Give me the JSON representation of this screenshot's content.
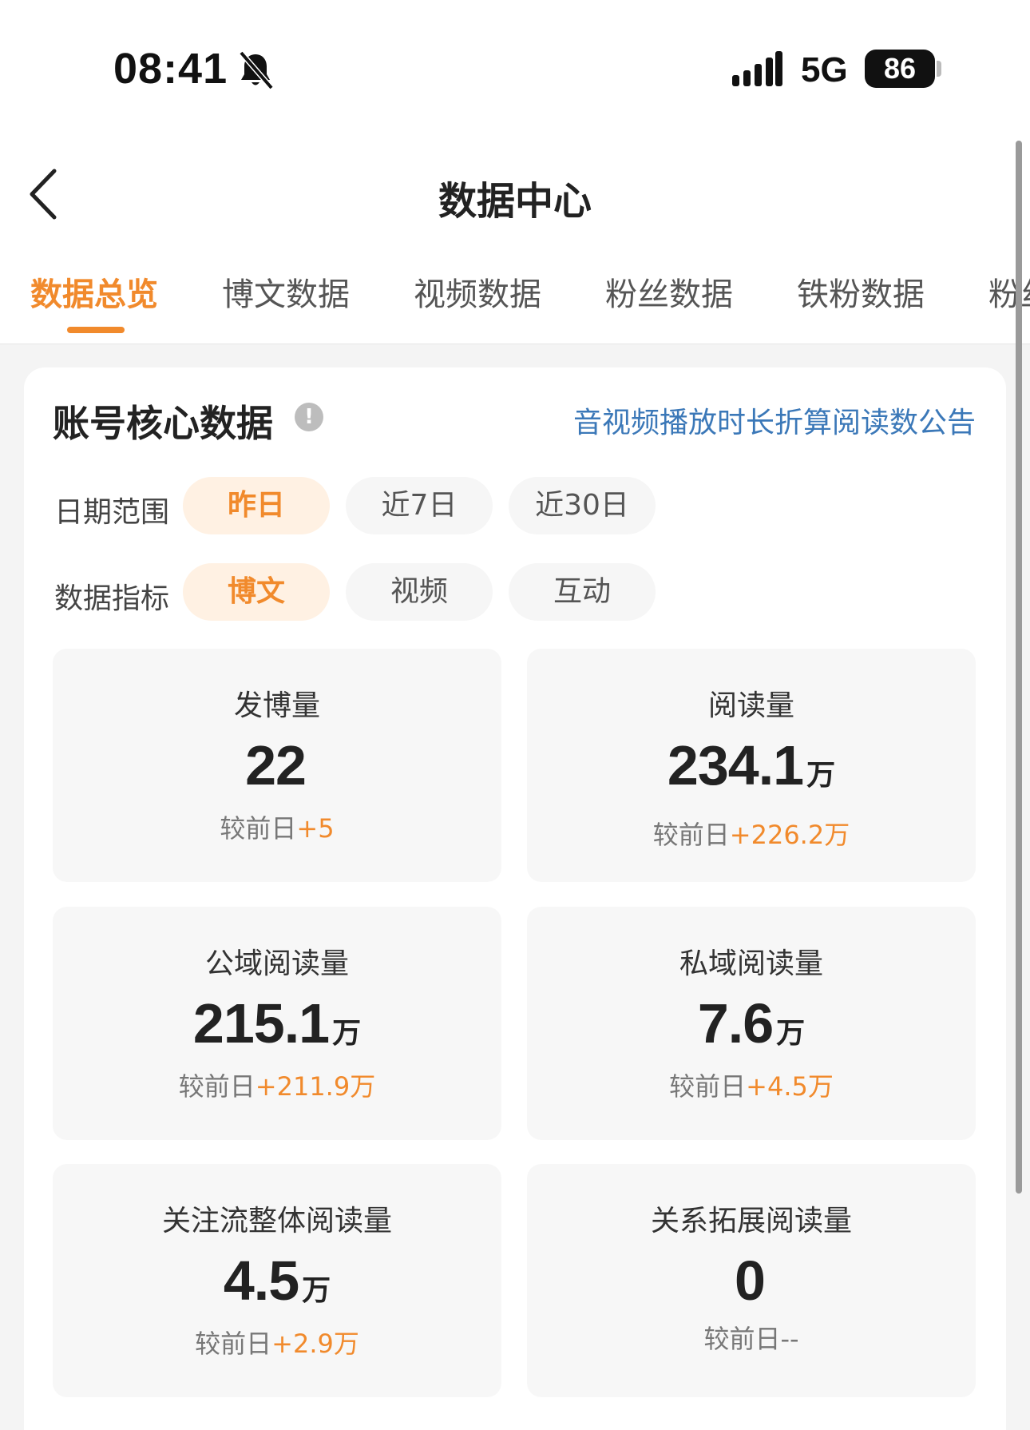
{
  "status_bar": {
    "time": "08:41",
    "network": "5G",
    "battery": "86",
    "icons": [
      "bell-slash-icon",
      "signal-icon"
    ]
  },
  "nav": {
    "title": "数据中心",
    "back_icon": "chevron-left-icon"
  },
  "tabs": [
    {
      "label": "数据总览",
      "active": true
    },
    {
      "label": "博文数据",
      "active": false
    },
    {
      "label": "视频数据",
      "active": false
    },
    {
      "label": "粉丝数据",
      "active": false
    },
    {
      "label": "铁粉数据",
      "active": false
    },
    {
      "label": "粉丝",
      "active": false
    }
  ],
  "card": {
    "title": "账号核心数据",
    "info_icon": "!",
    "notice_link": "音视频播放时长折算阅读数公告",
    "date_range": {
      "label": "日期范围",
      "options": [
        "昨日",
        "近7日",
        "近30日"
      ],
      "selected": "昨日"
    },
    "metric_type": {
      "label": "数据指标",
      "options": [
        "博文",
        "视频",
        "互动"
      ],
      "selected": "博文"
    },
    "metrics": [
      {
        "label": "发博量",
        "value": "22",
        "unit": "",
        "compare_label": "较前日",
        "delta": "+5"
      },
      {
        "label": "阅读量",
        "value": "234.1",
        "unit": "万",
        "compare_label": "较前日",
        "delta": "+226.2万"
      },
      {
        "label": "公域阅读量",
        "value": "215.1",
        "unit": "万",
        "compare_label": "较前日",
        "delta": "+211.9万"
      },
      {
        "label": "私域阅读量",
        "value": "7.6",
        "unit": "万",
        "compare_label": "较前日",
        "delta": "+4.5万"
      },
      {
        "label": "关注流整体阅读量",
        "value": "4.5",
        "unit": "万",
        "compare_label": "较前日",
        "delta": "+2.9万"
      },
      {
        "label": "关系拓展阅读量",
        "value": "0",
        "unit": "",
        "compare_label": "较前日",
        "delta": "--"
      }
    ]
  },
  "colors": {
    "accent": "#f18a2c",
    "accent_bg": "#fff1e3",
    "link": "#3b78b8",
    "page_bg": "#f4f4f4",
    "tile_bg": "#f7f7f7"
  }
}
